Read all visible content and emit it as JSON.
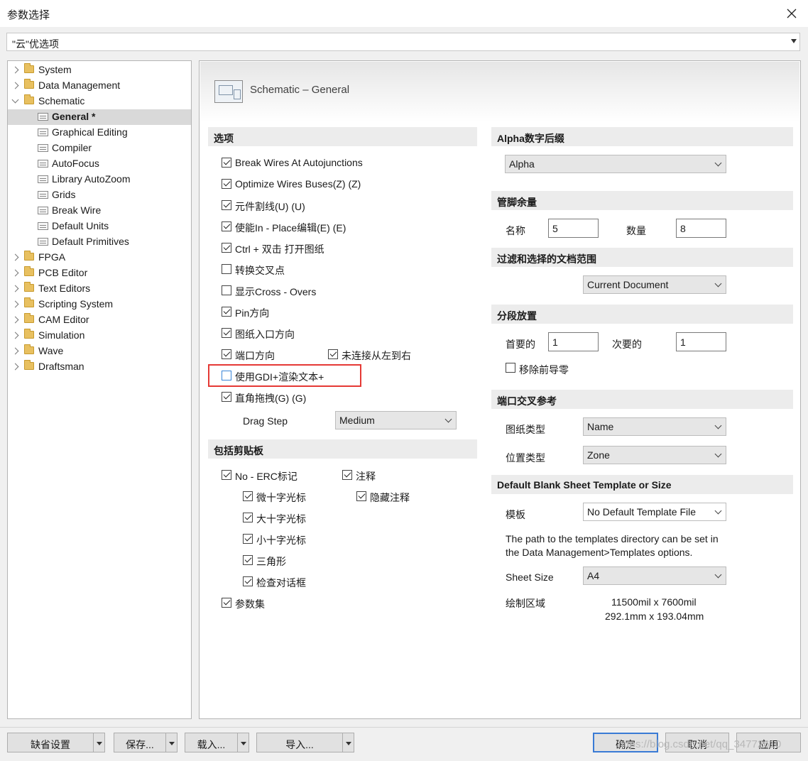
{
  "window": {
    "title": "参数选择"
  },
  "top_combo": {
    "value": "\"云\"优选项"
  },
  "tree": [
    {
      "label": "System",
      "type": "folder",
      "expanded": false,
      "level": 0
    },
    {
      "label": "Data Management",
      "type": "folder",
      "expanded": false,
      "level": 0
    },
    {
      "label": "Schematic",
      "type": "folder",
      "expanded": true,
      "level": 0
    },
    {
      "label": "General *",
      "type": "page",
      "level": 1,
      "selected": true
    },
    {
      "label": "Graphical Editing",
      "type": "page",
      "level": 1
    },
    {
      "label": "Compiler",
      "type": "page",
      "level": 1
    },
    {
      "label": "AutoFocus",
      "type": "page",
      "level": 1
    },
    {
      "label": "Library AutoZoom",
      "type": "page",
      "level": 1
    },
    {
      "label": "Grids",
      "type": "page",
      "level": 1
    },
    {
      "label": "Break Wire",
      "type": "page",
      "level": 1
    },
    {
      "label": "Default Units",
      "type": "page",
      "level": 1
    },
    {
      "label": "Default Primitives",
      "type": "page",
      "level": 1
    },
    {
      "label": "FPGA",
      "type": "folder",
      "expanded": false,
      "level": 0
    },
    {
      "label": "PCB Editor",
      "type": "folder",
      "expanded": false,
      "level": 0
    },
    {
      "label": "Text Editors",
      "type": "folder",
      "expanded": false,
      "level": 0
    },
    {
      "label": "Scripting System",
      "type": "folder",
      "expanded": false,
      "level": 0
    },
    {
      "label": "CAM Editor",
      "type": "folder",
      "expanded": false,
      "level": 0
    },
    {
      "label": "Simulation",
      "type": "folder",
      "expanded": false,
      "level": 0
    },
    {
      "label": "Wave",
      "type": "folder",
      "expanded": false,
      "level": 0
    },
    {
      "label": "Draftsman",
      "type": "folder",
      "expanded": false,
      "level": 0
    }
  ],
  "panel": {
    "title": "Schematic – General"
  },
  "options": {
    "header": "选项",
    "items": [
      {
        "label": "Break Wires At Autojunctions",
        "checked": true
      },
      {
        "label": "Optimize Wires Buses(Z) (Z)",
        "checked": true
      },
      {
        "label": "元件割线(U) (U)",
        "checked": true
      },
      {
        "label": "使能In - Place编辑(E) (E)",
        "checked": true
      },
      {
        "label": "Ctrl + 双击 打开图纸",
        "checked": true
      },
      {
        "label": "转换交叉点",
        "checked": false
      },
      {
        "label": "显示Cross - Overs",
        "checked": false
      },
      {
        "label": "Pin方向",
        "checked": true
      },
      {
        "label": "图纸入口方向",
        "checked": true
      },
      {
        "label": "端口方向",
        "checked": true
      },
      {
        "label": "使用GDI+渲染文本+",
        "checked": false
      },
      {
        "label": "直角拖拽(G) (G)",
        "checked": true
      }
    ],
    "unconnected_left_to_right": {
      "label": "未连接从左到右",
      "checked": true
    },
    "drag_step_label": "Drag Step",
    "drag_step_value": "Medium"
  },
  "clipboard": {
    "header": "包括剪贴板",
    "no_erc": {
      "label": "No - ERC标记",
      "checked": true
    },
    "annotation": {
      "label": "注释",
      "checked": true
    },
    "hidden_annotation": {
      "label": "隐藏注释",
      "checked": true
    },
    "sub_items": [
      {
        "label": "微十字光标",
        "checked": true
      },
      {
        "label": "大十字光标",
        "checked": true
      },
      {
        "label": "小十字光标",
        "checked": true
      },
      {
        "label": "三角形",
        "checked": true
      },
      {
        "label": "检查对话框",
        "checked": true
      }
    ],
    "param_set": {
      "label": "参数集",
      "checked": true
    }
  },
  "alpha": {
    "header": "Alpha数字后缀",
    "value": "Alpha"
  },
  "pin_margin": {
    "header": "管脚余量",
    "name_label": "名称",
    "name_value": "5",
    "count_label": "数量",
    "count_value": "8"
  },
  "filter_scope": {
    "header": "过滤和选择的文档范围",
    "value": "Current Document"
  },
  "segment_place": {
    "header": "分段放置",
    "primary_label": "首要的",
    "primary_value": "1",
    "secondary_label": "次要的",
    "secondary_value": "1",
    "remove_leading_zero": {
      "label": "移除前导零",
      "checked": false
    }
  },
  "port_cross_ref": {
    "header": "端口交叉参考",
    "sheet_type_label": "图纸类型",
    "sheet_type_value": "Name",
    "location_type_label": "位置类型",
    "location_type_value": "Zone"
  },
  "template": {
    "header": "Default Blank Sheet Template or Size",
    "template_label": "模板",
    "template_value": "No Default Template File",
    "info_line1": "The path to the templates directory can be set in",
    "info_line2": "the Data Management>Templates options.",
    "sheet_size_label": "Sheet Size",
    "sheet_size_value": "A4",
    "draw_area_label": "绘制区域",
    "draw_area_line1": "11500mil x 7600mil",
    "draw_area_line2": "292.1mm x 193.04mm"
  },
  "buttons": {
    "defaults": "缺省设置",
    "save": "保存...",
    "load": "载入...",
    "import": "导入...",
    "ok": "确定",
    "cancel": "取消",
    "apply": "应用"
  },
  "watermark": "https://blog.csdn.net/qq_34772610",
  "colors": {
    "highlight": "#e53935",
    "default_button_border": "#3a7bd5"
  }
}
